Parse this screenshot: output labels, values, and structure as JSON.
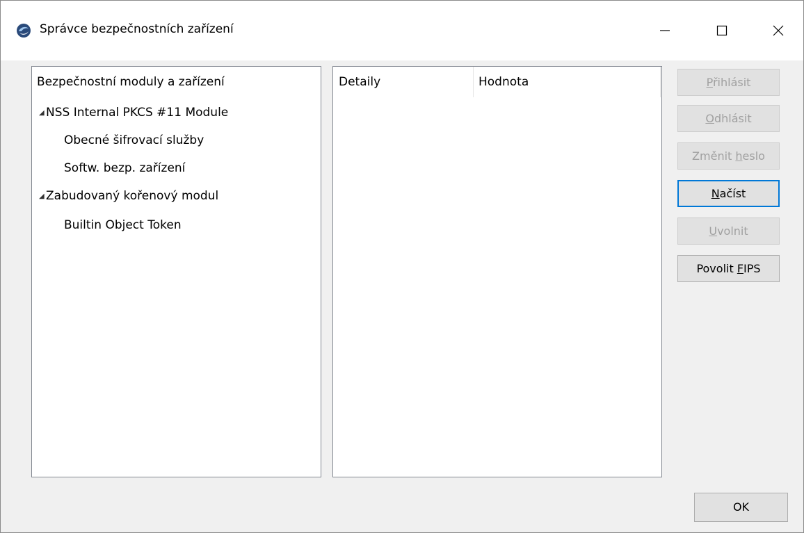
{
  "window": {
    "title": "Správce bezpečnostních zařízení",
    "icon": "thunderbird-icon",
    "controls": {
      "minimize_icon": "minimize-icon",
      "maximize_icon": "maximize-icon",
      "close_icon": "close-icon"
    }
  },
  "modules_panel": {
    "header": "Bezpečnostní moduly a zařízení",
    "tree": [
      {
        "label": "NSS Internal PKCS #11 Module",
        "level": 0,
        "expanded": true
      },
      {
        "label": "Obecné šifrovací služby",
        "level": 1
      },
      {
        "label": "Softw. bezp. zařízení",
        "level": 1
      },
      {
        "label": "Zabudovaný kořenový modul",
        "level": 0,
        "expanded": true
      },
      {
        "label": "Builtin Object Token",
        "level": 1
      }
    ]
  },
  "details_panel": {
    "col_details": "Detaily",
    "col_value": "Hodnota"
  },
  "buttons": {
    "login": {
      "pre": "",
      "key": "P",
      "post": "řihlásit",
      "enabled": false
    },
    "logout": {
      "pre": "",
      "key": "O",
      "post": "dhlásit",
      "enabled": false
    },
    "change_password": {
      "pre": "Změnit ",
      "key": "h",
      "post": "eslo",
      "enabled": false
    },
    "load": {
      "pre": "",
      "key": "N",
      "post": "ačíst",
      "enabled": true,
      "default": true
    },
    "unload": {
      "pre": "",
      "key": "U",
      "post": "volnit",
      "enabled": false
    },
    "fips": {
      "pre": "Povolit ",
      "key": "F",
      "post": "IPS",
      "enabled": true
    },
    "ok": "OK"
  },
  "colors": {
    "accent": "#0078d7",
    "disabled_text": "#a0a0a0",
    "panel_border": "#828790"
  }
}
